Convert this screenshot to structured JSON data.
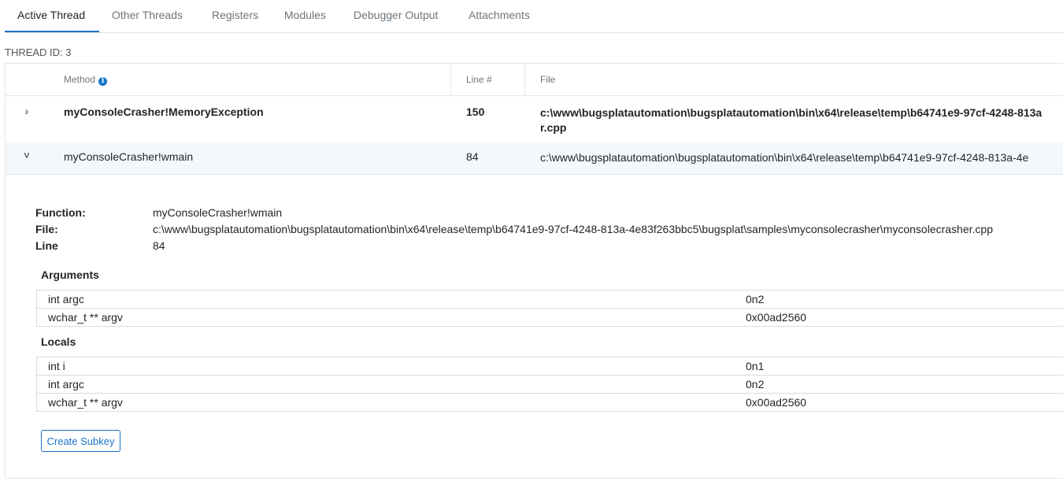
{
  "tabs": [
    {
      "label": "Active Thread",
      "active": true
    },
    {
      "label": "Other Threads"
    },
    {
      "label": "Registers"
    },
    {
      "label": "Modules"
    },
    {
      "label": "Debugger Output"
    },
    {
      "label": "Attachments"
    }
  ],
  "thread_id_label": "THREAD ID: 3",
  "stack": {
    "headers": {
      "method": "Method",
      "line": "Line #",
      "file": "File"
    },
    "rows": [
      {
        "chevron": "›",
        "method": "myConsoleCrasher!MemoryException",
        "line": "150",
        "file": "c:\\www\\bugsplatautomation\\bugsplatautomation\\bin\\x64\\release\\temp\\b64741e9-97cf-4248-813a\nr.cpp"
      },
      {
        "chevron": "˅",
        "method": "myConsoleCrasher!wmain",
        "line": "84",
        "file": "c:\\www\\bugsplatautomation\\bugsplatautomation\\bin\\x64\\release\\temp\\b64741e9-97cf-4248-813a-4e"
      }
    ]
  },
  "detail": {
    "function_label": "Function:",
    "function_value": "myConsoleCrasher!wmain",
    "file_label": "File:",
    "file_value": "c:\\www\\bugsplatautomation\\bugsplatautomation\\bin\\x64\\release\\temp\\b64741e9-97cf-4248-813a-4e83f263bbc5\\bugsplat\\samples\\myconsolecrasher\\myconsolecrasher.cpp",
    "line_label": "Line",
    "line_value": "84",
    "arguments_title": "Arguments",
    "arguments": [
      {
        "name": "int argc",
        "value": "0n2"
      },
      {
        "name": "wchar_t ** argv",
        "value": "0x00ad2560"
      }
    ],
    "locals_title": "Locals",
    "locals": [
      {
        "name": "int i",
        "value": "0n1"
      },
      {
        "name": "int argc",
        "value": "0n2"
      },
      {
        "name": "wchar_t ** argv",
        "value": "0x00ad2560"
      }
    ],
    "create_subkey_label": "Create Subkey"
  },
  "colors": {
    "accent": "#1a73c9",
    "border": "#e3e6ea",
    "muted": "#6c757d"
  },
  "icons": {
    "info": "info-icon",
    "expand": "chevron-right-icon",
    "collapse": "chevron-down-icon"
  }
}
